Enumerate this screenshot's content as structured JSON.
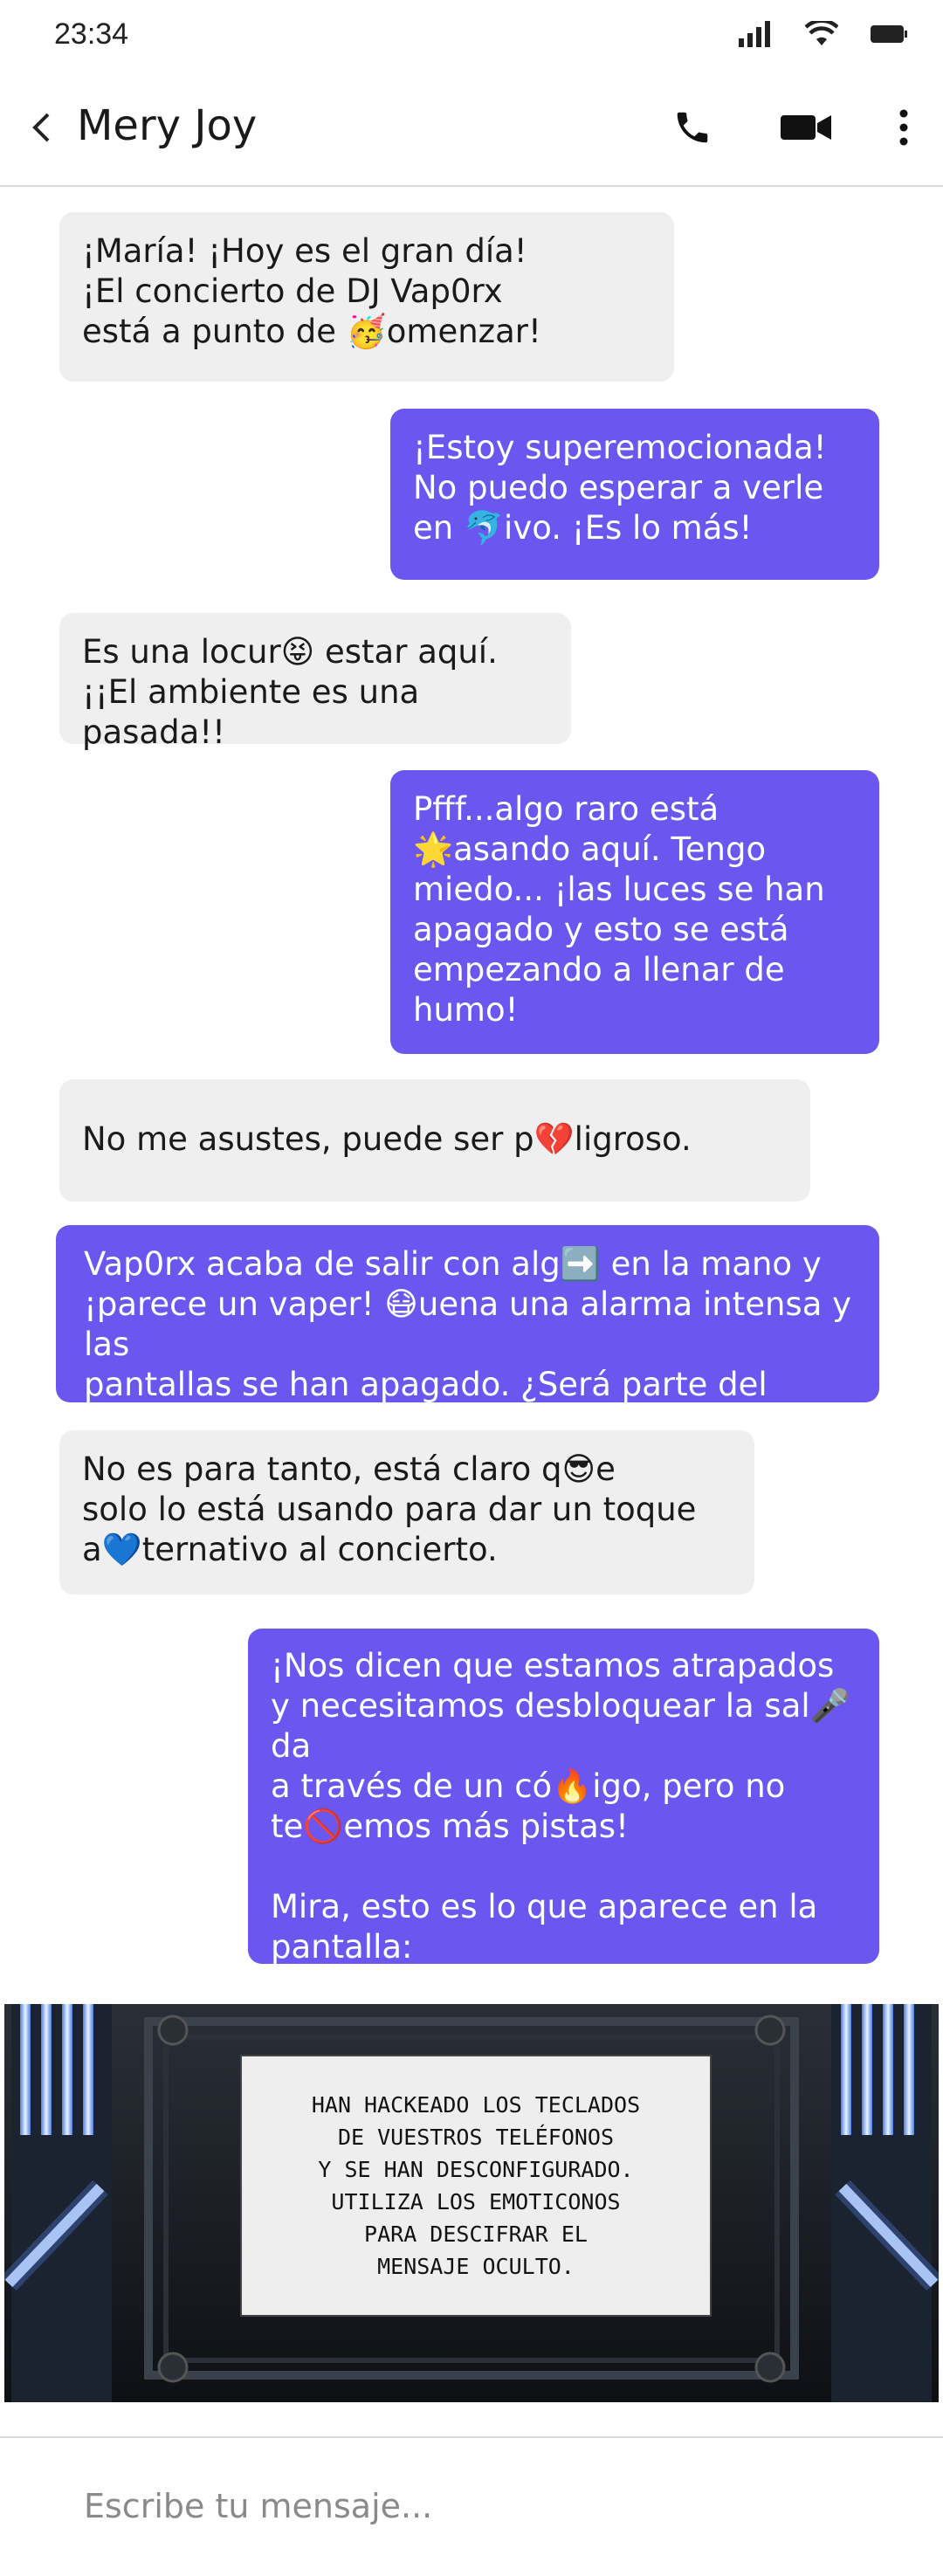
{
  "status_bar": {
    "time": "23:34"
  },
  "header": {
    "contact_name": "Mery Joy"
  },
  "messages": [
    {
      "direction": "incoming",
      "text": "¡María! ¡Hoy es el gran día!\n¡El concierto de DJ Vap0rx\nestá a punto de 🥳omenzar!"
    },
    {
      "direction": "outgoing",
      "text": "¡Estoy superemocionada!\nNo puedo esperar a verle\nen 🐬ivo. ¡Es lo más!"
    },
    {
      "direction": "incoming",
      "text": "Es una locur😝 estar aquí.\n¡¡El ambiente es una pasada!!"
    },
    {
      "direction": "outgoing",
      "text": " Pfff...algo raro está\n🌟asando aquí. Tengo\nmiedo... ¡las luces se han\napagado y esto se está\nempezando a llenar de\nhumo!"
    },
    {
      "direction": "incoming",
      "text": "No me asustes, puede ser p💔ligroso."
    },
    {
      "direction": "outgoing",
      "text": " Vap0rx acaba de salir con alg➡️  en la mano y\n¡parece un vaper! 😷uena una alarma intensa y las\npantallas se han apagado. ¿Será parte del show?"
    },
    {
      "direction": "incoming",
      "text": " No es para tanto, está claro q😎e\nsolo lo está usando para dar un toque\na💙ternativo al concierto."
    },
    {
      "direction": "outgoing",
      "text": "¡Nos dicen que estamos atrapados\ny necesitamos desbloquear la sal🎤da\na través de un có🔥igo, pero no\nte🚫emos más pistas!\n\nMira, esto es lo que aparece en la\npantalla:"
    }
  ],
  "image_message": {
    "text": "HAN HACKEADO LOS TECLADOS\nDE VUESTROS TELÉFONOS\nY SE HAN DESCONFIGURADO.\nUTILIZA LOS EMOTICONOS\nPARA DESCIFRAR EL\nMENSAJE OCULTO."
  },
  "composer": {
    "placeholder": "Escribe tu mensaje..."
  },
  "colors": {
    "outgoing_bubble": "#6b56f0",
    "incoming_bubble": "#efefef"
  },
  "icons": [
    "signal-icon",
    "wifi-icon",
    "battery-icon",
    "back-arrow-icon",
    "phone-icon",
    "video-camera-icon",
    "more-vertical-icon"
  ]
}
